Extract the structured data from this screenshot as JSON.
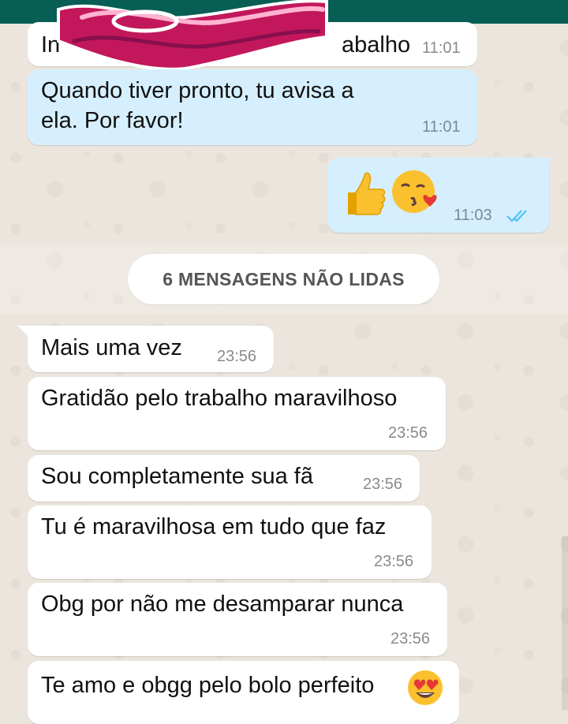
{
  "messages": [
    {
      "id": "m0",
      "dir": "in",
      "text": "In",
      "text_tail": "abalho",
      "time": "11:01"
    },
    {
      "id": "m1",
      "dir": "in",
      "text_line1": "Quando tiver pronto, tu avisa a",
      "text_line2": "ela. Por favor!",
      "time": "11:01"
    },
    {
      "id": "m2",
      "dir": "out",
      "emojis": [
        "thumbs-up",
        "kissing-face-with-heart"
      ],
      "time": "11:03",
      "status": "delivered"
    },
    {
      "id": "m3",
      "dir": "in",
      "text": "Mais uma vez",
      "time": "23:56"
    },
    {
      "id": "m4",
      "dir": "in",
      "text": "Gratidão pelo trabalho maravilhoso",
      "time": "23:56"
    },
    {
      "id": "m5",
      "dir": "in",
      "text": "Sou completamente sua fã",
      "time": "23:56"
    },
    {
      "id": "m6",
      "dir": "in",
      "text": "Tu é maravilhosa em tudo que faz",
      "time": "23:56"
    },
    {
      "id": "m7",
      "dir": "in",
      "text": "Obg por não me desamparar nunca",
      "time": "23:56"
    },
    {
      "id": "m8",
      "dir": "in",
      "text": "Te amo e obgg pelo bolo perfeito",
      "emoji": "heart-eyes"
    }
  ],
  "unread_banner": "6 MENSAGENS NÃO LIDAS",
  "colors": {
    "header": "#075e54",
    "incoming": "#ffffff",
    "outgoing": "#d6efff",
    "tick": "#4fc3f7",
    "sticker": "#c2185b"
  }
}
